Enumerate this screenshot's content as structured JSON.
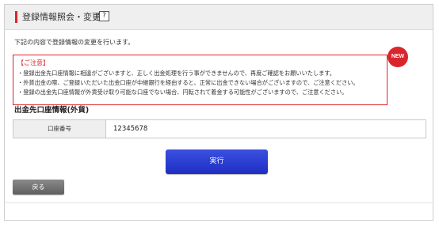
{
  "header": {
    "title": "登録情報照会・変更",
    "help_icon": "?"
  },
  "intro_text": "下記の内容で登録情報の変更を行います。",
  "notice": {
    "badge": "NEW",
    "title": "【ご注意】",
    "lines": [
      "・登録出金先口座情報に相違がございますと、正しく出金処理を行う事ができませんので、再度ご確認をお願いいたします。",
      "・外貨出金の際、ご登録いただいた出金口座が中継銀行を経由すると、正常に出金できない場合がございますので、ご注意ください。",
      "・登録の出金先口座情報が外貨受け取り可能な口座でない場合、円転されて着金する可能性がございますので、ご注意ください。"
    ]
  },
  "section_title": "出金先口座情報(外貨)",
  "table": {
    "rows": [
      {
        "label": "口座番号",
        "value": "12345678"
      }
    ]
  },
  "buttons": {
    "execute": "実行",
    "back": "戻る"
  },
  "colors": {
    "accent_red": "#d9262c",
    "execute_blue": "#2a3cd6",
    "back_gray": "#6f6f6f"
  }
}
